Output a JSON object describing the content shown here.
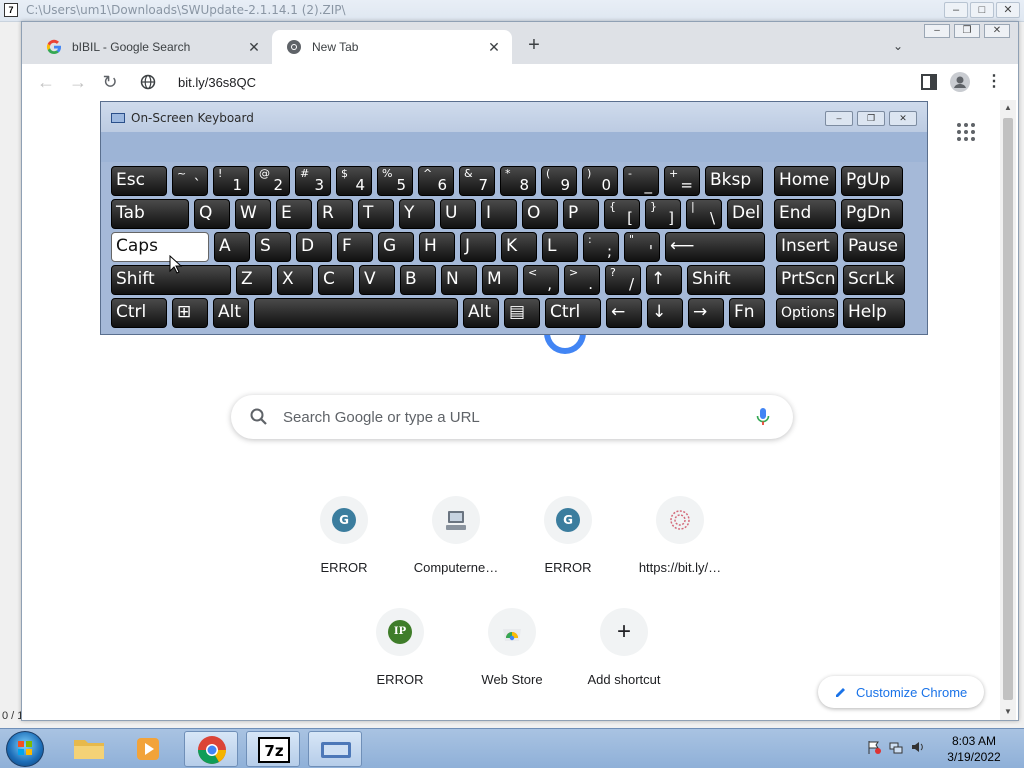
{
  "background_window": {
    "title": "C:\\Users\\um1\\Downloads\\SWUpdate-2.1.14.1 (2).ZIP\\",
    "status_text": "0 / 1"
  },
  "chrome": {
    "tabs": [
      {
        "label": "bIBIL - Google Search",
        "close": "✕"
      },
      {
        "label": "New Tab",
        "close": "✕"
      }
    ],
    "newtab_symbol": "+",
    "tabsearch_symbol": "⌄",
    "url": "bit.ly/36s8QC",
    "menu_symbol": "⋮"
  },
  "newtab_page": {
    "search_placeholder": "Search Google or type a URL",
    "shortcuts": [
      {
        "label": "ERROR",
        "badge": "G"
      },
      {
        "label": "Computerne…",
        "badge": ""
      },
      {
        "label": "ERROR",
        "badge": "G"
      },
      {
        "label": "https://bit.ly/…",
        "badge": ""
      },
      {
        "label": "ERROR",
        "badge": "IP"
      },
      {
        "label": "Web Store",
        "badge": ""
      },
      {
        "label": "Add shortcut",
        "badge": "+"
      }
    ],
    "customize_label": "Customize Chrome"
  },
  "osk": {
    "title": "On-Screen Keyboard",
    "rows": [
      [
        {
          "main": "Esc",
          "w": 58
        },
        {
          "sup": "~",
          "sub": "`",
          "w": 38
        },
        {
          "sup": "!",
          "sub": "1",
          "w": 38
        },
        {
          "sup": "@",
          "sub": "2",
          "w": 38
        },
        {
          "sup": "#",
          "sub": "3",
          "w": 38
        },
        {
          "sup": "$",
          "sub": "4",
          "w": 38
        },
        {
          "sup": "%",
          "sub": "5",
          "w": 38
        },
        {
          "sup": "^",
          "sub": "6",
          "w": 38
        },
        {
          "sup": "&",
          "sub": "7",
          "w": 38
        },
        {
          "sup": "*",
          "sub": "8",
          "w": 38
        },
        {
          "sup": "(",
          "sub": "9",
          "w": 38
        },
        {
          "sup": ")",
          "sub": "0",
          "w": 38
        },
        {
          "sup": "-",
          "sub": "_",
          "w": 38
        },
        {
          "sup": "+",
          "sub": "=",
          "w": 38
        },
        {
          "main": "Bksp",
          "w": 60
        },
        {
          "main": "Home",
          "w": 64,
          "gap": 6
        },
        {
          "main": "PgUp",
          "w": 64
        }
      ],
      [
        {
          "main": "Tab",
          "w": 80
        },
        {
          "main": "Q",
          "w": 38
        },
        {
          "main": "W",
          "w": 38
        },
        {
          "main": "E",
          "w": 38
        },
        {
          "main": "R",
          "w": 38
        },
        {
          "main": "T",
          "w": 38
        },
        {
          "main": "Y",
          "w": 38
        },
        {
          "main": "U",
          "w": 38
        },
        {
          "main": "I",
          "w": 38
        },
        {
          "main": "O",
          "w": 38
        },
        {
          "main": "P",
          "w": 38
        },
        {
          "sup": "{",
          "sub": "[",
          "w": 38
        },
        {
          "sup": "}",
          "sub": "]",
          "w": 38
        },
        {
          "sup": "|",
          "sub": "\\",
          "w": 38
        },
        {
          "main": "Del",
          "w": 38
        },
        {
          "main": "End",
          "w": 64,
          "gap": 6
        },
        {
          "main": "PgDn",
          "w": 64
        }
      ],
      [
        {
          "main": "Caps",
          "w": 100,
          "caps": true
        },
        {
          "main": "A",
          "w": 38
        },
        {
          "main": "S",
          "w": 38
        },
        {
          "main": "D",
          "w": 38
        },
        {
          "main": "F",
          "w": 38
        },
        {
          "main": "G",
          "w": 38
        },
        {
          "main": "H",
          "w": 38
        },
        {
          "main": "J",
          "w": 38
        },
        {
          "main": "K",
          "w": 38
        },
        {
          "main": "L",
          "w": 38
        },
        {
          "sup": ":",
          "sub": ";",
          "w": 38
        },
        {
          "sup": "\"",
          "sub": "'",
          "w": 38
        },
        {
          "main": "⟵",
          "w": 102
        },
        {
          "main": "Insert",
          "w": 64,
          "gap": 6
        },
        {
          "main": "Pause",
          "w": 64
        }
      ],
      [
        {
          "main": "Shift",
          "w": 122
        },
        {
          "main": "Z",
          "w": 38
        },
        {
          "main": "X",
          "w": 38
        },
        {
          "main": "C",
          "w": 38
        },
        {
          "main": "V",
          "w": 38
        },
        {
          "main": "B",
          "w": 38
        },
        {
          "main": "N",
          "w": 38
        },
        {
          "main": "M",
          "w": 38
        },
        {
          "sup": "<",
          "sub": ",",
          "w": 38
        },
        {
          "sup": ">",
          "sub": ".",
          "w": 38
        },
        {
          "sup": "?",
          "sub": "/",
          "w": 38
        },
        {
          "main": "↑",
          "w": 38
        },
        {
          "main": "Shift",
          "w": 80
        },
        {
          "main": "PrtScn",
          "w": 64,
          "gap": 6
        },
        {
          "main": "ScrLk",
          "w": 64
        }
      ],
      [
        {
          "main": "Ctrl",
          "w": 58
        },
        {
          "main": "⊞",
          "w": 38
        },
        {
          "main": "Alt",
          "w": 38
        },
        {
          "main": "",
          "w": 206
        },
        {
          "main": "Alt",
          "w": 38
        },
        {
          "main": "▤",
          "w": 38
        },
        {
          "main": "Ctrl",
          "w": 58
        },
        {
          "main": "←",
          "w": 38
        },
        {
          "main": "↓",
          "w": 38
        },
        {
          "main": "→",
          "w": 38
        },
        {
          "main": "Fn",
          "w": 38
        },
        {
          "main": "Options",
          "w": 64,
          "gap": 6,
          "small": true
        },
        {
          "main": "Help",
          "w": 64
        }
      ]
    ]
  },
  "taskbar": {
    "time": "8:03 AM",
    "date": "3/19/2022"
  },
  "colors": {
    "osk_body": "#a5b9d8",
    "key_face": "#1b1b1b",
    "accent": "#1a73e8"
  }
}
